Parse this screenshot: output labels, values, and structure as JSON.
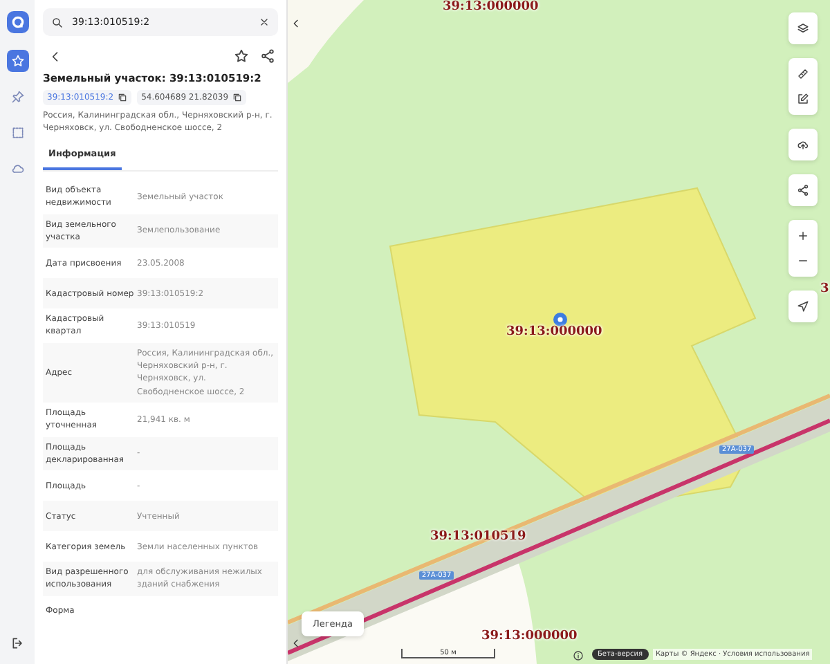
{
  "rail_items": [
    {
      "selected": true
    },
    {
      "selected": false
    },
    {
      "selected": false
    },
    {
      "selected": false
    }
  ],
  "search": {
    "value": "39:13:010519:2"
  },
  "object": {
    "title": "Земельный участок: 39:13:010519:2",
    "cadastral_number": "39:13:010519:2",
    "coordinates": "54.604689 21.82039",
    "address": "Россия, Калининградская обл., Черняховский р-н, г. Черняховск, ул. Свободненское шоссе, 2"
  },
  "tabs": [
    {
      "label": "Информация",
      "selected": true
    }
  ],
  "properties": [
    {
      "label": "Вид объекта недвижимости",
      "value": "Земельный участок"
    },
    {
      "label": "Вид земельного участка",
      "value": "Землепользование"
    },
    {
      "label": "Дата присвоения",
      "value": "23.05.2008"
    },
    {
      "label": "Кадастровый номер",
      "value": "39:13:010519:2"
    },
    {
      "label": "Кадастровый квартал",
      "value": "39:13:010519"
    },
    {
      "label": "Адрес",
      "value": "Россия, Калининградская обл., Черняховский р-н, г. Черняховск, ул. Свободненское шоссе, 2"
    },
    {
      "label": "Площадь уточненная",
      "value": "21,941 кв. м"
    },
    {
      "label": "Площадь декларированная",
      "value": "-"
    },
    {
      "label": "Площадь",
      "value": "-"
    },
    {
      "label": "Статус",
      "value": "Учтенный"
    },
    {
      "label": "Категория земель",
      "value": "Земли населенных пунктов"
    },
    {
      "label": "Вид разрешенного использования",
      "value": "для обслуживания нежилых зданий снабжения"
    },
    {
      "label": "Форма"
    }
  ],
  "map": {
    "parcel_labels": [
      "39:13:000000",
      "39:13:000000",
      "39:13:010519",
      "39:13:000000",
      "3"
    ],
    "road_labels": [
      "27А-037",
      "27А-037"
    ],
    "legend": "Легенда",
    "scale": "50 м",
    "beta_badge": "Бета-версия",
    "attribution": "Карты © Яндекс · Условия использования"
  }
}
